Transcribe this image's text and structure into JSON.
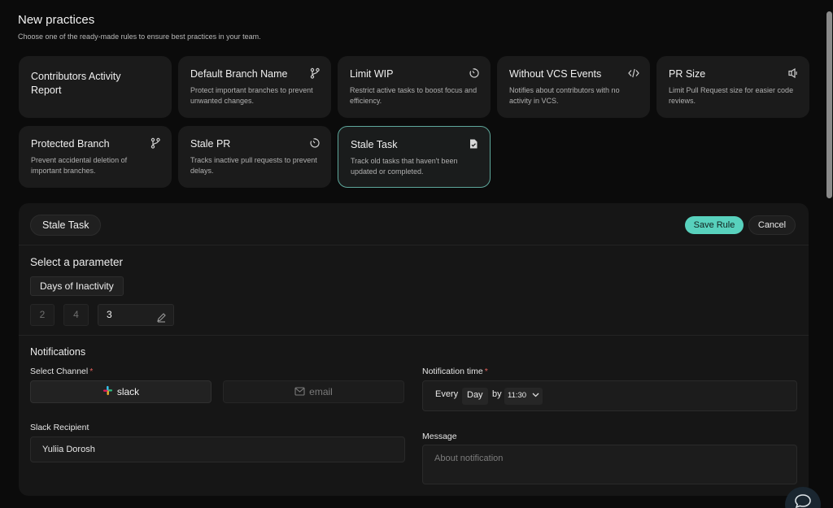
{
  "header": {
    "title": "New practices",
    "subtitle": "Choose one of the ready-made rules to ensure best practices in your team."
  },
  "cards": [
    {
      "title": "Contributors Activity Report",
      "desc": "",
      "icon": null
    },
    {
      "title": "Default Branch Name",
      "desc": "Protect important branches to prevent unwanted changes.",
      "icon": "branch-icon"
    },
    {
      "title": "Limit WIP",
      "desc": "Restrict active tasks to boost focus and efficiency.",
      "icon": "timer-icon"
    },
    {
      "title": "Without VCS Events",
      "desc": "Notifies about contributors with no activity in VCS.",
      "icon": "code-icon"
    },
    {
      "title": "PR Size",
      "desc": "Limit Pull Request size for easier code reviews.",
      "icon": "speaker-icon"
    },
    {
      "title": "Protected Branch",
      "desc": "Prevent accidental deletion of important branches.",
      "icon": "branch-icon"
    },
    {
      "title": "Stale PR",
      "desc": "Tracks inactive pull requests to prevent delays.",
      "icon": "timer-icon"
    },
    {
      "title": "Stale Task",
      "desc": "Track old tasks that haven't been updated or completed.",
      "icon": "document-check-icon",
      "selected": true
    }
  ],
  "panel": {
    "rule_name": "Stale Task",
    "save_label": "Save Rule",
    "cancel_label": "Cancel",
    "param_title": "Select a parameter",
    "param_name": "Days of Inactivity",
    "values": [
      "2",
      "4"
    ],
    "custom_value": "3",
    "notifications": {
      "title": "Notifications",
      "channel_label": "Select Channel",
      "channels": {
        "slack": "slack",
        "email": "email"
      },
      "selected_channel": "slack",
      "recipient_label": "Slack Recipient",
      "recipient_value": "Yuliia Dorosh",
      "time_label": "Notification time",
      "time": {
        "every": "Every",
        "period": "Day",
        "by": "by",
        "clock": "11:30"
      },
      "message_label": "Message",
      "message_placeholder": "About notification"
    }
  },
  "colors": {
    "accent": "#58d1bd",
    "required": "#e0605a",
    "selected_border": "#5ea79b"
  }
}
